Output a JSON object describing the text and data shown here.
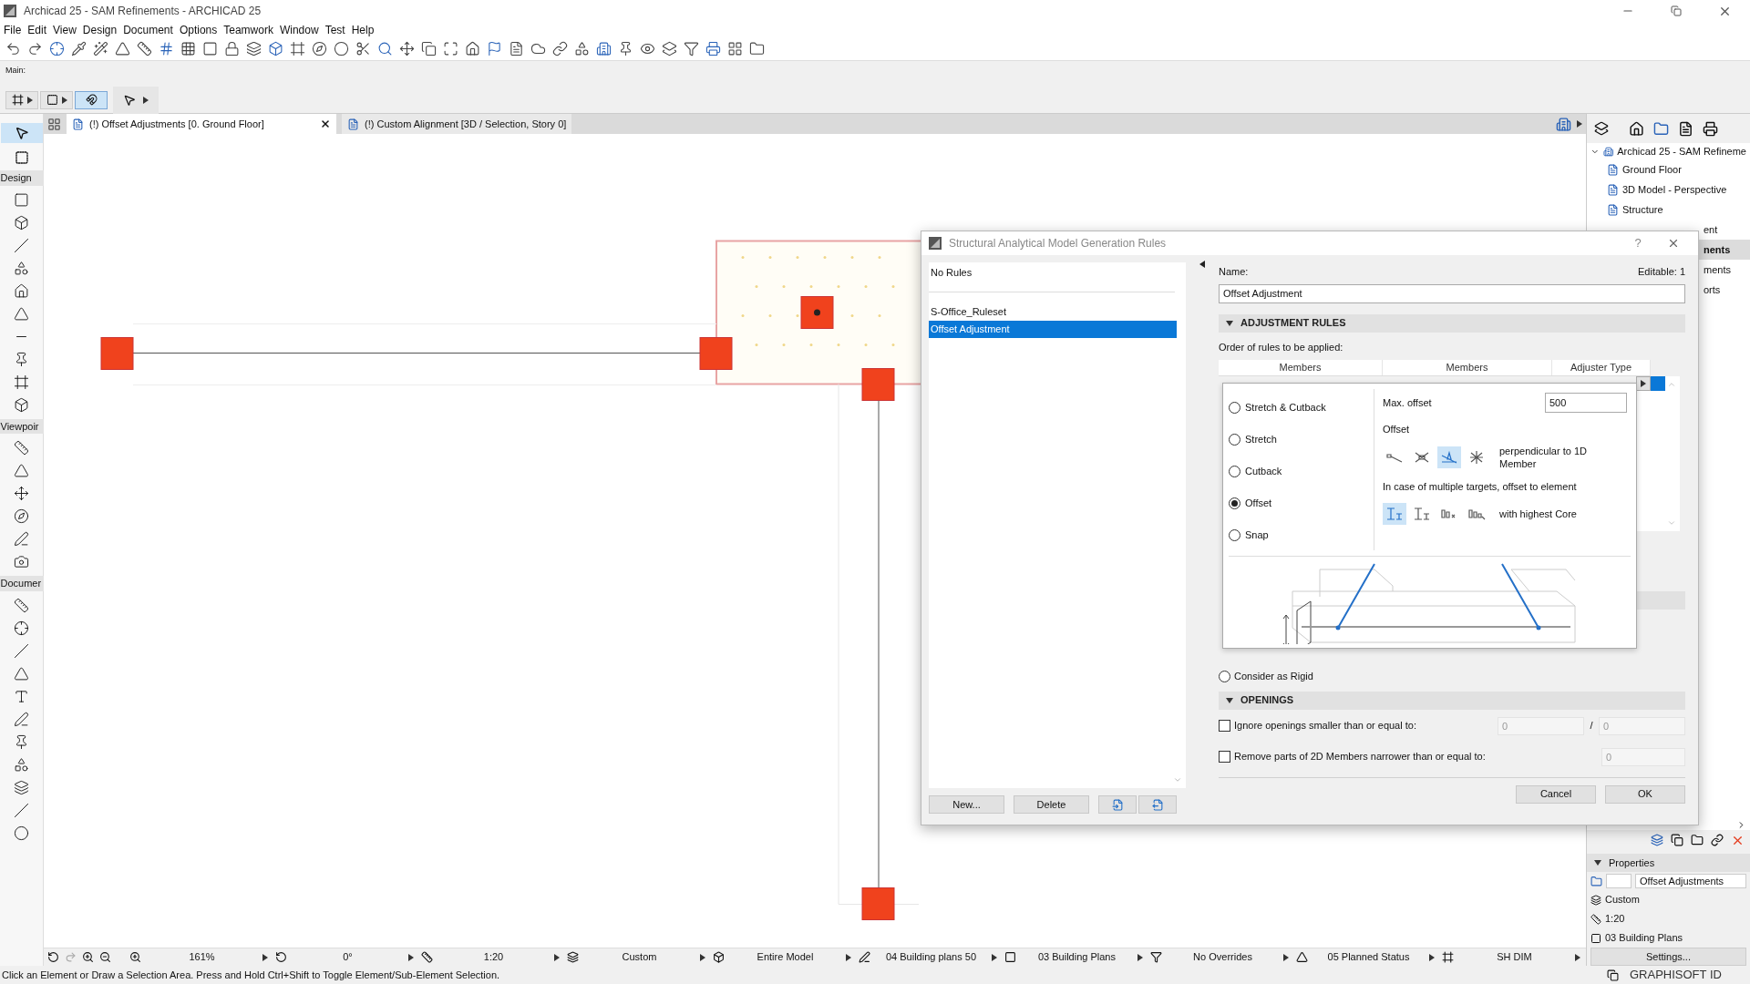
{
  "app_window": {
    "title": "Archicad 25 - SAM Refinements - ARCHICAD 25"
  },
  "menu": [
    "File",
    "Edit",
    "View",
    "Design",
    "Document",
    "Options",
    "Teamwork",
    "Window",
    "Test",
    "Help"
  ],
  "main_toolbar_label": "Main:",
  "view_tabs": [
    {
      "label": "(!) Offset Adjustments [0. Ground Floor]",
      "selected": true
    },
    {
      "label": "(!) Custom Alignment [3D / Selection, Story 0]",
      "selected": false
    }
  ],
  "toolbox": {
    "sections": [
      "Design",
      "Viewpoir",
      "Documer"
    ]
  },
  "navigator": {
    "tree": [
      {
        "label": "Archicad 25 - SAM Refineme",
        "expanded": true,
        "selected": false,
        "children": [
          {
            "label": "Ground Floor",
            "selected": false
          },
          {
            "label": "3D Model - Perspective",
            "selected": false
          },
          {
            "label": "Structure",
            "selected": false
          },
          {
            "label": "ent",
            "selected": false
          },
          {
            "label": "nents",
            "selected": true
          },
          {
            "label": "ments",
            "selected": false
          },
          {
            "label": "orts",
            "selected": false
          }
        ]
      }
    ]
  },
  "properties": {
    "title": "Properties",
    "expanded": true,
    "name_value": "Offset Adjustments",
    "rows": [
      "Custom",
      "1:20",
      "03 Building Plans"
    ],
    "settings_button": "Settings..."
  },
  "status_bar": {
    "items": [
      "161%",
      "0°",
      "1:20",
      "Custom",
      "Entire Model",
      "04 Building plans 50",
      "03 Building Plans",
      "No Overrides",
      "05 Planned Status",
      "SH DIM"
    ]
  },
  "hint": "Click an Element or Draw a Selection Area. Press and Hold Ctrl+Shift to Toggle Element/Sub-Element Selection.",
  "graphisoft_id": "GRAPHISOFT ID",
  "dialog": {
    "title": "Structural Analytical Model Generation Rules",
    "help": "?",
    "rulesets": [
      {
        "label": "No Rules",
        "selected": false
      },
      {
        "label": "S-Office_Ruleset",
        "selected": false
      },
      {
        "label": "Offset Adjustment",
        "selected": true
      }
    ],
    "new_button": "New...",
    "delete_button": "Delete",
    "name_label": "Name:",
    "name_value": "Offset Adjustment",
    "editable": "Editable: 1",
    "adjustment_section": {
      "title": "ADJUSTMENT RULES",
      "expanded": true,
      "order_label": "Order of rules to be applied:",
      "columns": [
        "Members",
        "Members",
        "Adjuster Type"
      ]
    },
    "adjuster_popup": {
      "types": [
        {
          "label": "Stretch & Cutback",
          "selected": false
        },
        {
          "label": "Stretch",
          "selected": false
        },
        {
          "label": "Cutback",
          "selected": false
        },
        {
          "label": "Offset",
          "selected": true
        },
        {
          "label": "Snap",
          "selected": false
        }
      ],
      "max_offset_label": "Max. offset",
      "max_offset_value": "500",
      "offset_label": "Offset",
      "offset_modes": [
        {
          "selected": false
        },
        {
          "selected": false
        },
        {
          "selected": true
        },
        {
          "selected": false
        }
      ],
      "offset_mode_text": "perpendicular to 1D Member",
      "target_label": "In case of multiple targets, offset to element",
      "target_modes": [
        {
          "selected": true
        },
        {
          "selected": false
        },
        {
          "selected": false
        },
        {
          "selected": false
        }
      ],
      "target_mode_text": "with highest Core"
    },
    "rigid_option": {
      "label": "Consider as Rigid",
      "selected": false
    },
    "openings_section": {
      "title": "OPENINGS",
      "expanded": true,
      "ignore": {
        "label": "Ignore openings smaller than or equal to:",
        "checked": false,
        "values": [
          "0",
          "0"
        ],
        "separator": "/"
      },
      "remove": {
        "label": "Remove parts of 2D Members narrower than or equal to:",
        "checked": false,
        "value": "0"
      }
    },
    "cancel_button": "Cancel",
    "ok_button": "OK"
  }
}
